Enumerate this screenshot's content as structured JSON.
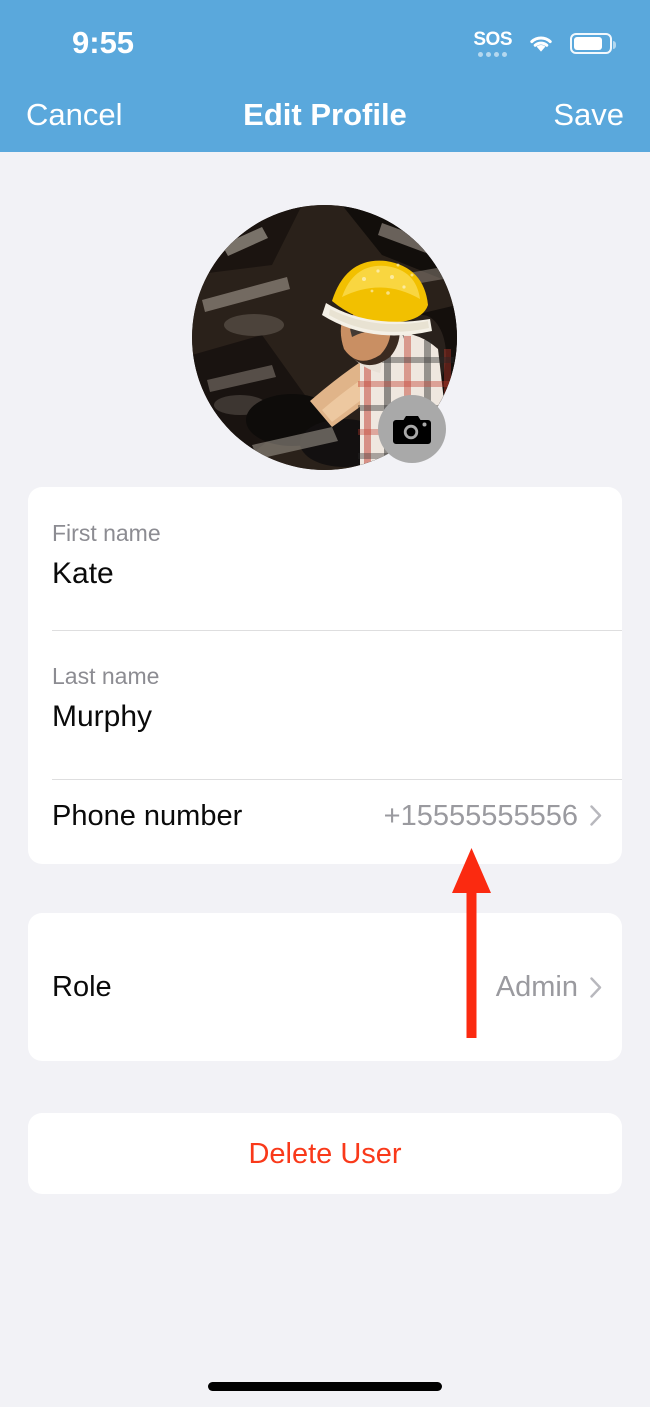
{
  "status_bar": {
    "time": "9:55",
    "sos_label": "SOS",
    "wifi_icon": "wifi-icon",
    "battery_icon": "battery-icon",
    "sos_dots_count": 4
  },
  "navbar": {
    "cancel_label": "Cancel",
    "title": "Edit Profile",
    "save_label": "Save",
    "background_color": "#5aa8dc",
    "text_color": "#ffffff"
  },
  "avatar": {
    "name": "profile-photo",
    "description": "worker wearing yellow hard hat",
    "camera_badge_icon": "camera-icon"
  },
  "form": {
    "fields": [
      {
        "label": "First name",
        "value": "Kate"
      },
      {
        "label": "Last name",
        "value": "Murphy"
      }
    ],
    "phone_row": {
      "label": "Phone number",
      "value": "+15555555556",
      "chevron_icon": "chevron-right-icon"
    },
    "role_row": {
      "label": "Role",
      "value": "Admin",
      "chevron_icon": "chevron-right-icon"
    }
  },
  "delete": {
    "label": "Delete User",
    "color": "#f9391a"
  },
  "annotation": {
    "type": "arrow",
    "direction": "up",
    "color": "#fb2a10",
    "points_at": "Phone number"
  },
  "colors": {
    "page_background": "#f2f2f6",
    "card_background": "#ffffff",
    "accent_blue": "#5aa8dc",
    "label_gray": "#8c8c92",
    "value_gray": "#9a9a9f",
    "destructive_red": "#f9391a"
  }
}
